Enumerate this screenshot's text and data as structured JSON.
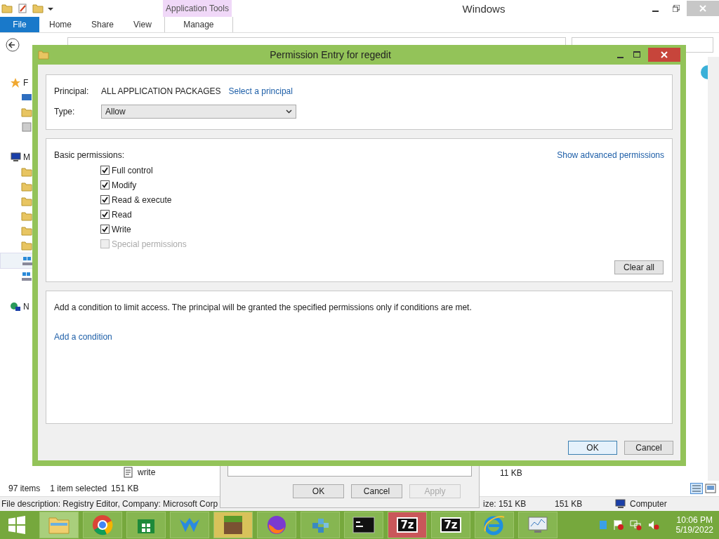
{
  "explorer": {
    "title": "Windows",
    "context_group": "Application Tools",
    "ribbon_tabs": [
      {
        "label": "File",
        "kind": "file",
        "selected": false
      },
      {
        "label": "Home",
        "kind": "tab",
        "selected": false
      },
      {
        "label": "Share",
        "kind": "tab",
        "selected": false
      },
      {
        "label": "View",
        "kind": "tab",
        "selected": false
      },
      {
        "label": "Manage",
        "kind": "context",
        "selected": false
      }
    ],
    "sidebar": [
      {
        "label": "F",
        "kind": "star",
        "selected": false
      },
      {
        "kind": "desktop",
        "selected": false
      },
      {
        "kind": "folder",
        "selected": false
      },
      {
        "kind": "recent",
        "selected": false
      },
      {
        "label": "M",
        "kind": "computer",
        "selected": false
      },
      {
        "kind": "folder",
        "selected": false
      },
      {
        "kind": "folder",
        "selected": false
      },
      {
        "kind": "folder",
        "selected": false
      },
      {
        "kind": "folder",
        "selected": false
      },
      {
        "kind": "folder",
        "selected": false
      },
      {
        "kind": "folder",
        "selected": false
      },
      {
        "kind": "drive",
        "selected": true
      },
      {
        "kind": "drive",
        "selected": false
      },
      {
        "label": "N",
        "kind": "network",
        "selected": false
      }
    ],
    "file_row": {
      "name": "write",
      "size": "11 KB"
    },
    "status": {
      "count": "97 items",
      "selection": "1 item selected",
      "size": "151 KB"
    },
    "details_bar": {
      "description": "File description: Registry Editor, Company: Microsoft Corp",
      "size": "ize: 151 KB",
      "size_value": "151 KB",
      "location": "Computer"
    }
  },
  "properties_dialog": {
    "buttons": [
      {
        "label": "OK",
        "disabled": false
      },
      {
        "label": "Cancel",
        "disabled": false
      },
      {
        "label": "Apply",
        "disabled": true
      }
    ]
  },
  "dialog": {
    "title": "Permission Entry for regedit",
    "principal_label": "Principal:",
    "principal": "ALL APPLICATION PACKAGES",
    "select_link": "Select a principal",
    "type_label": "Type:",
    "type_value": "Allow",
    "permissions_label": "Basic permissions:",
    "advanced_link": "Show advanced permissions",
    "permissions": [
      {
        "label": "Full control",
        "checked": true,
        "disabled": false
      },
      {
        "label": "Modify",
        "checked": true,
        "disabled": false
      },
      {
        "label": "Read & execute",
        "checked": true,
        "disabled": false
      },
      {
        "label": "Read",
        "checked": true,
        "disabled": false
      },
      {
        "label": "Write",
        "checked": true,
        "disabled": false
      },
      {
        "label": "Special permissions",
        "checked": false,
        "disabled": true
      }
    ],
    "clear_button": "Clear all",
    "condition_text": "Add a condition to limit access. The principal will be granted the specified permissions only if conditions are met.",
    "condition_link": "Add a condition",
    "buttons": [
      {
        "label": "OK",
        "default": true
      },
      {
        "label": "Cancel",
        "default": false
      }
    ]
  },
  "taskbar": {
    "items": [
      {
        "kind": "explorer",
        "color": "#a9cf7c"
      },
      {
        "kind": "chrome",
        "color": "#86b651"
      },
      {
        "kind": "store",
        "color": "#86b651"
      },
      {
        "kind": "wing",
        "color": "#86b651"
      },
      {
        "kind": "block",
        "color": "#d8c25a"
      },
      {
        "kind": "fox",
        "color": "#86b651"
      },
      {
        "kind": "cubes",
        "color": "#86b651"
      },
      {
        "kind": "console",
        "color": "#86b651"
      },
      {
        "kind": "sevenzip",
        "label": "7z",
        "color": "#c9575a"
      },
      {
        "kind": "sevenzip",
        "label": "7z",
        "color": "#86b651"
      },
      {
        "kind": "ie",
        "color": "#86b651"
      },
      {
        "kind": "monitor",
        "color": "#86b651"
      }
    ],
    "time": "10:06 PM",
    "date": "5/19/2022"
  }
}
